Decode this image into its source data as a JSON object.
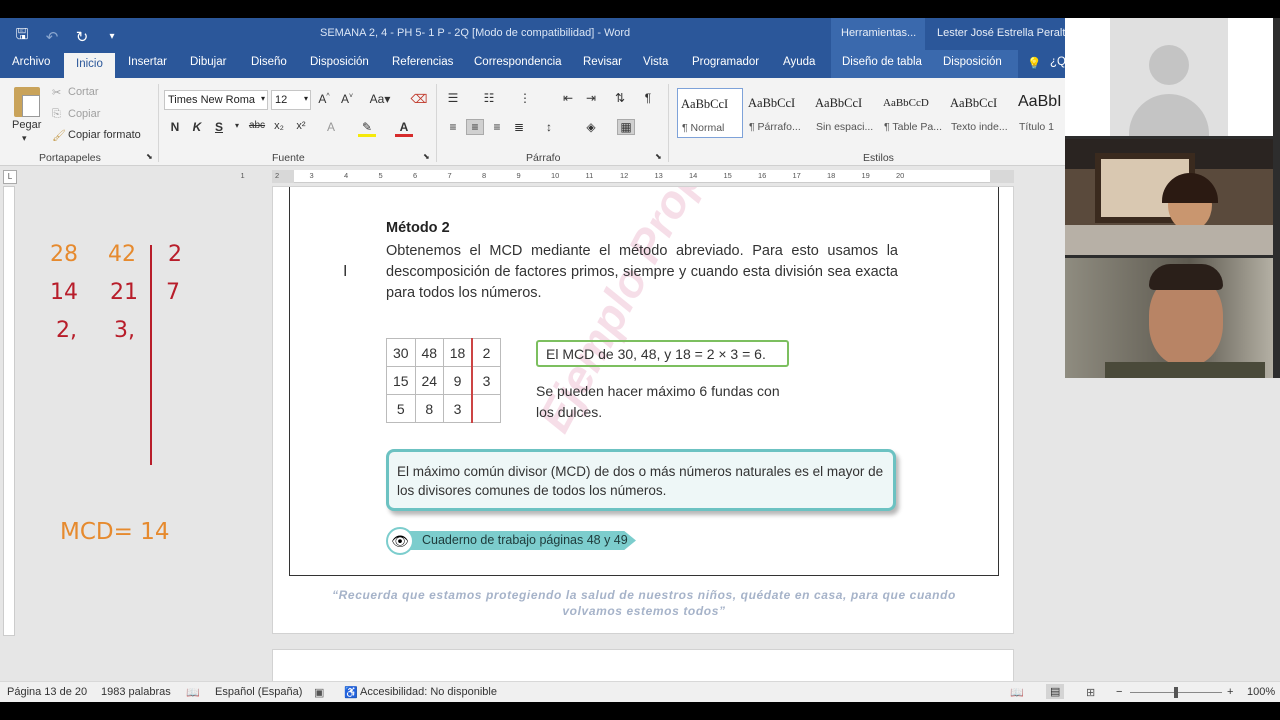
{
  "window": {
    "doc_title": "SEMANA 2, 4 - PH 5- 1 P - 2Q [Modo de compatibilidad]  -  Word",
    "tools_label": "Herramientas...",
    "user_name": "Lester José Estrella Peralta"
  },
  "tabs": [
    "Archivo",
    "Inicio",
    "Insertar",
    "Dibujar",
    "Diseño",
    "Disposición",
    "Referencias",
    "Correspondencia",
    "Revisar",
    "Vista",
    "Programador",
    "Ayuda",
    "Diseño de tabla",
    "Disposición",
    "¿Q"
  ],
  "ribbon": {
    "clipboard": {
      "paste": "Pegar",
      "cut": "Cortar",
      "copy": "Copiar",
      "format_painter": "Copiar formato",
      "label": "Portapapeles"
    },
    "font": {
      "name": "Times New Roma",
      "size": "12",
      "bold": "N",
      "italic": "K",
      "underline": "S",
      "strike": "abc",
      "sub": "x₂",
      "sup": "x²",
      "label": "Fuente"
    },
    "paragraph": {
      "label": "Párrafo"
    },
    "styles": {
      "label": "Estilos",
      "items": [
        {
          "sample": "AaBbCcI",
          "name": "¶ Normal"
        },
        {
          "sample": "AaBbCcI",
          "name": "¶ Párrafo..."
        },
        {
          "sample": "AaBbCcI",
          "name": "Sin espaci..."
        },
        {
          "sample": "AaBbCcD",
          "name": "¶ Table Pa..."
        },
        {
          "sample": "AaBbCcI",
          "name": "Texto inde..."
        },
        {
          "sample": "AaBbI",
          "name": "Título 1"
        }
      ]
    }
  },
  "ruler": {
    "marks": [
      "1",
      "2",
      "3",
      "4",
      "5",
      "6",
      "7",
      "8",
      "9",
      "10",
      "11",
      "12",
      "13",
      "14",
      "15",
      "16",
      "17",
      "18",
      "19",
      "20"
    ]
  },
  "handwritten": {
    "row1": [
      "28",
      "42",
      "2"
    ],
    "row2": [
      "14",
      "21",
      "7"
    ],
    "row3": [
      "2,",
      "3,"
    ],
    "result": "MCD= 14"
  },
  "page": {
    "watermark": "Ejemplo Propiedad",
    "title": "Método 2",
    "paragraph": "Obtenemos el MCD mediante el método abreviado. Para esto usamos la descomposición de factores primos, siempre y cuando esta división sea exacta para todos los números.",
    "table": [
      [
        "30",
        "48",
        "18",
        "2"
      ],
      [
        "15",
        "24",
        "9",
        "3"
      ],
      [
        "5",
        "8",
        "3",
        ""
      ]
    ],
    "mcd_box": "El MCD de 30, 48, y 18 = 2 × 3 = 6.",
    "note": "Se pueden hacer máximo 6 fundas con los dulces.",
    "definition": "El máximo común divisor (MCD) de dos o más números naturales es el mayor de los divisores comunes de todos los números.",
    "workbook": "Cuaderno de trabajo páginas 48 y 49",
    "quote": "“Recuerda que estamos protegiendo la salud de nuestros niños, quédate en casa, para que cuando volvamos estemos todos”"
  },
  "status": {
    "page": "Página 13 de 20",
    "words": "1983 palabras",
    "language": "Español (España)",
    "accessibility": "Accesibilidad: No disponible",
    "zoom": "100%"
  },
  "video": {
    "participants": 3
  },
  "colors": {
    "word_blue": "#2b579a",
    "handwriting_orange": "#e68a2e",
    "handwriting_red": "#b81d2a",
    "teal": "#6cc2c2"
  }
}
